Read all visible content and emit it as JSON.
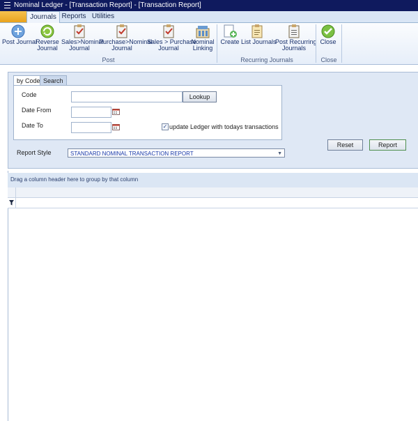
{
  "window": {
    "title": "Nominal Ledger - [Transaction Report] - [Transaction Report]"
  },
  "ribbon_tabs": [
    "Journals",
    "Reports",
    "Utilities"
  ],
  "ribbon": {
    "post_group": {
      "label": "Post",
      "buttons": [
        {
          "line1": "Post Journal",
          "line2": ""
        },
        {
          "line1": "Reverse",
          "line2": "Journal"
        },
        {
          "line1": "Sales>Nominal",
          "line2": "Journal"
        },
        {
          "line1": "Purchase>Nominal",
          "line2": "Journal"
        },
        {
          "line1": "Sales > Purchase",
          "line2": "Journal"
        },
        {
          "line1": "Nominal",
          "line2": "Linking"
        }
      ]
    },
    "recurring_group": {
      "label": "Recurring Journals",
      "buttons": [
        {
          "line1": "Create",
          "line2": ""
        },
        {
          "line1": "List Journals",
          "line2": ""
        },
        {
          "line1": "Post Recurring",
          "line2": "Journals"
        }
      ]
    },
    "close_group": {
      "label": "Close",
      "buttons": [
        {
          "line1": "Close",
          "line2": ""
        }
      ]
    }
  },
  "filter": {
    "tabs": [
      "by Code",
      "Search"
    ],
    "code_label": "Code",
    "code_value": "",
    "lookup_label": "Lookup",
    "date_from_label": "Date From",
    "date_from_value": "",
    "date_to_label": "Date To",
    "date_to_value": "",
    "update_ledger_label": "update Ledger with todays transactions",
    "update_ledger_checked": true,
    "report_style_label": "Report Style",
    "report_style_value": "STANDARD NOMINAL TRANSACTION REPORT",
    "reset_label": "Reset",
    "report_label": "Report"
  },
  "grid": {
    "group_hint": "Drag a column header here to group by that column"
  },
  "colors": {
    "titlebar": "#0f1a5e",
    "file_tab": "#e9a21d",
    "panel": "#dfe8f5",
    "accent_text": "#1838a8"
  }
}
